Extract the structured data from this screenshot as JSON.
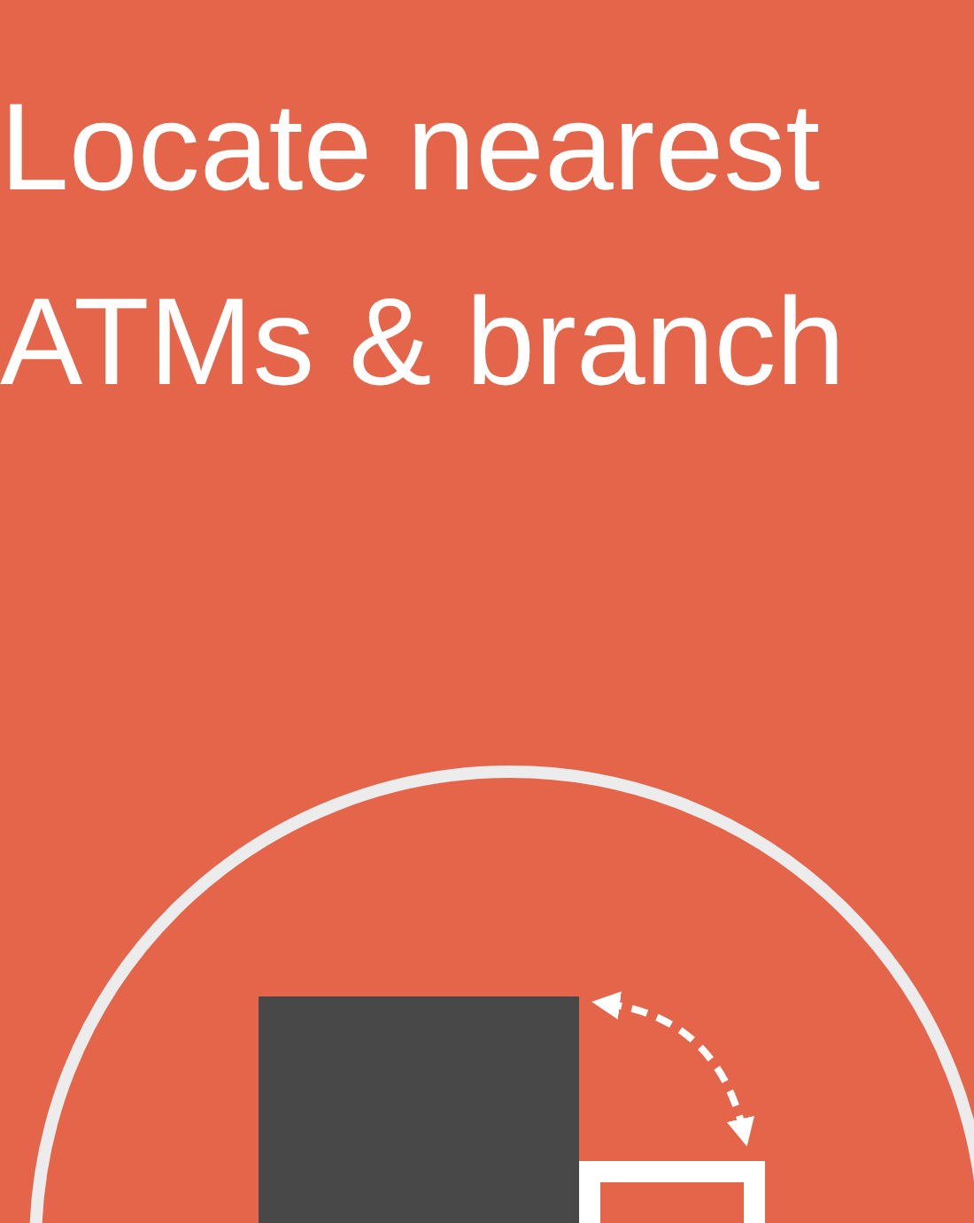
{
  "title": "Locate nearest ATMs & branch"
}
